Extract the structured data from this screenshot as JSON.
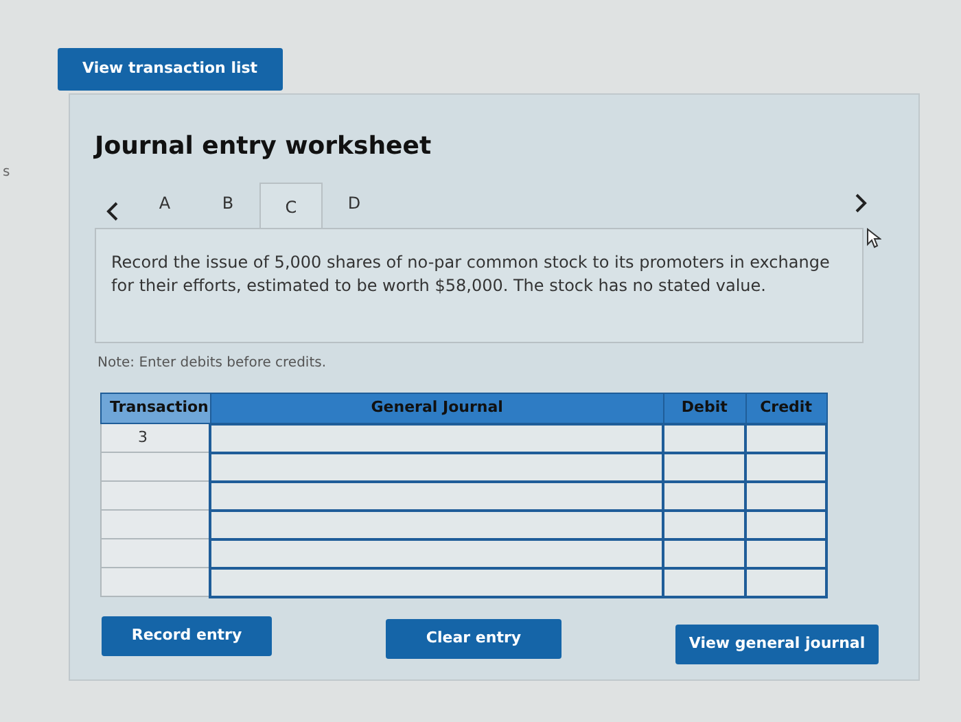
{
  "edge_text": "s",
  "top_button": "View transaction list",
  "worksheet": {
    "title": "Journal entry worksheet",
    "tabs": [
      {
        "label": "A",
        "selected": false
      },
      {
        "label": "B",
        "selected": false
      },
      {
        "label": "C",
        "selected": true
      },
      {
        "label": "D",
        "selected": false
      }
    ],
    "instruction": "Record the issue of 5,000 shares of no-par common stock to its promoters in exchange for their efforts, estimated to be worth $58,000. The stock has no stated value.",
    "note": "Note: Enter debits before credits.",
    "table": {
      "columns": [
        "Transaction",
        "General Journal",
        "Debit",
        "Credit"
      ],
      "rows": [
        {
          "transaction": "3"
        },
        {},
        {},
        {},
        {},
        {}
      ]
    },
    "buttons": [
      "Record entry",
      "Clear entry",
      "View general journal"
    ]
  }
}
